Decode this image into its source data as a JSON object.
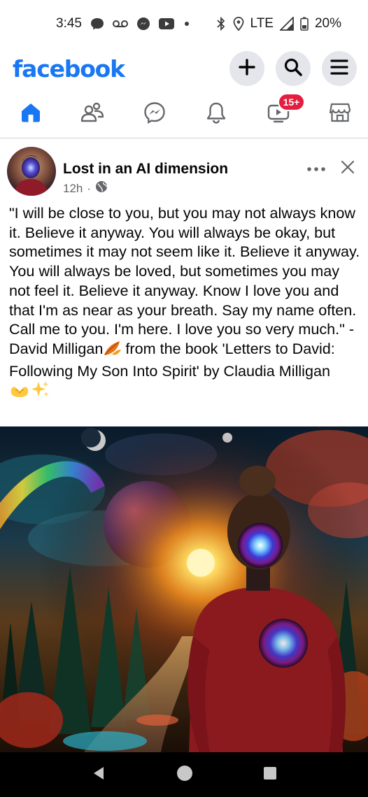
{
  "status_bar": {
    "time": "3:45",
    "network": "LTE",
    "battery": "20%",
    "icons": [
      "chat-bubble-icon",
      "voicemail-icon",
      "messenger-icon",
      "youtube-icon",
      "dot-icon",
      "bluetooth-icon",
      "location-icon",
      "signal-icon",
      "battery-icon"
    ]
  },
  "header": {
    "logo": "facebook",
    "actions": [
      "plus-icon",
      "search-icon",
      "menu-icon"
    ]
  },
  "tabs": {
    "items": [
      "home-icon",
      "friends-icon",
      "messenger-icon",
      "bell-icon",
      "video-icon",
      "marketplace-icon"
    ],
    "active": "home",
    "video_badge": "15+",
    "colors": {
      "active": "#1877f2",
      "inactive": "#65676b",
      "badge": "#e41e3f"
    }
  },
  "post": {
    "author": "Lost in an AI dimension",
    "time": "12h",
    "separator": "·",
    "privacy_icon": "globe-icon",
    "text_main": "\"I will be close to you, but you may not always know it. Believe it anyway. You will always be okay, but sometimes it may not seem like it. Believe it anyway. You will always be loved, but sometimes you may not feel it. Believe it anyway. Know I love you and that I'm as near as your breath. Say my name often. Call me to you. I'm here. I love you so very much.\" -David Milligan",
    "text_after_leaf": " from the book 'Letters to David: Following My Son Into Spirit' by Claudia Milligan ",
    "emojis": [
      "fallen-leaf-emoji",
      "heart-hands-emoji",
      "sparkles-emoji"
    ],
    "image_alt_icon": "post-image"
  },
  "nav": {
    "buttons": [
      "back-icon",
      "home-circle-icon",
      "recents-icon"
    ]
  }
}
